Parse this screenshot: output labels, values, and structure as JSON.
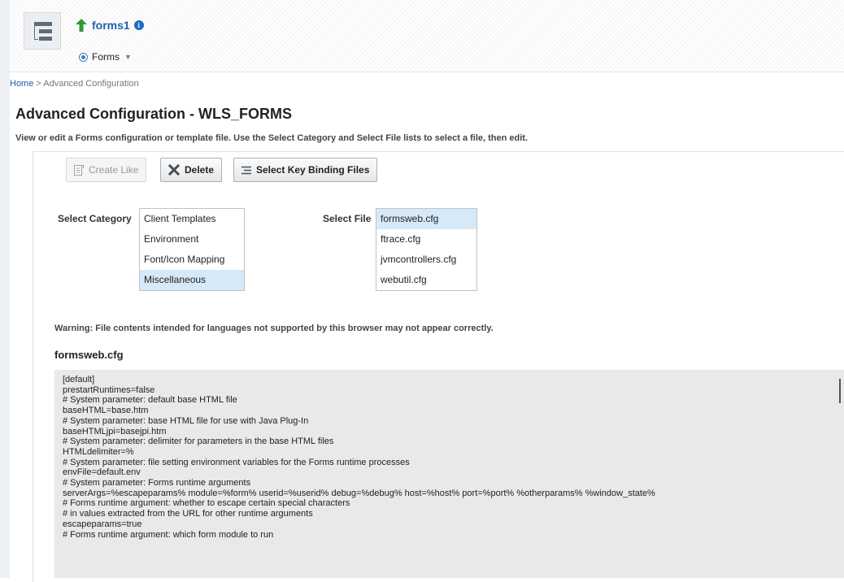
{
  "header": {
    "target_name": "forms1",
    "menu_label": "Forms"
  },
  "breadcrumb": {
    "home": "Home",
    "separator": ">",
    "current": "Advanced Configuration"
  },
  "page": {
    "title": "Advanced Configuration - WLS_FORMS",
    "instruction": "View or edit a Forms configuration or template file. Use the Select Category and Select File lists to select a file, then edit."
  },
  "toolbar": {
    "create_like": "Create Like",
    "delete": "Delete",
    "select_key_binding": "Select Key Binding Files"
  },
  "category": {
    "label": "Select Category",
    "options": [
      "Client Templates",
      "Environment",
      "Font/Icon Mapping",
      "Miscellaneous"
    ],
    "selected": "Miscellaneous"
  },
  "file": {
    "label": "Select File",
    "options": [
      "formsweb.cfg",
      "ftrace.cfg",
      "jvmcontrollers.cfg",
      "webutil.cfg"
    ],
    "selected": "formsweb.cfg"
  },
  "warning": "Warning: File contents intended for languages not supported by this browser may not appear correctly.",
  "file_title": "formsweb.cfg",
  "editor_lines": [
    "[default]",
    "prestartRuntimes=false",
    "# System parameter: default base HTML file",
    "baseHTML=base.htm",
    "# System parameter: base HTML file for use with Java Plug-In",
    "baseHTMLjpi=basejpi.htm",
    "# System parameter: delimiter for parameters in the base HTML files",
    "HTMLdelimiter=%",
    "# System parameter: file setting environment variables for the Forms runtime processes",
    "envFile=default.env",
    "# System parameter: Forms runtime arguments",
    "serverArgs=%escapeparams% module=%form% userid=%userid% debug=%debug% host=%host% port=%port% %otherparams% %window_state%",
    "# Forms runtime argument: whether to escape certain special characters",
    "# in values extracted from the URL for other runtime arguments",
    "escapeparams=true",
    "# Forms runtime argument: which form module to run"
  ],
  "colors": {
    "link_blue": "#1f5fa7",
    "selected_option": "#d6e9f8",
    "target_arrow": "#2e9a3a",
    "editor_bg": "#e9e9e9"
  },
  "icons": {
    "target_status": "up-arrow-icon",
    "info": "info-icon",
    "create_like": "copy-icon",
    "delete": "x-icon",
    "key_binding": "list-icon",
    "navigator": "target-navigator-icon"
  }
}
